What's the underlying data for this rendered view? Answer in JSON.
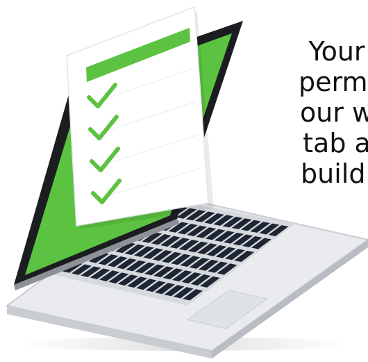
{
  "caption": {
    "lines": [
      "Your",
      "permi",
      "our w",
      "tab a",
      "buildi"
    ]
  },
  "colors": {
    "screen_green": "#5cc241",
    "checklist_green": "#5cc241",
    "laptop_body": "#e9ebee",
    "bezel": "#1b1d21",
    "keys": "#1e2633",
    "paper": "#ffffff"
  },
  "checklist": {
    "checked_items": 4
  },
  "icons": {
    "check": "check-icon",
    "laptop": "laptop-illustration",
    "document": "checklist-document"
  }
}
